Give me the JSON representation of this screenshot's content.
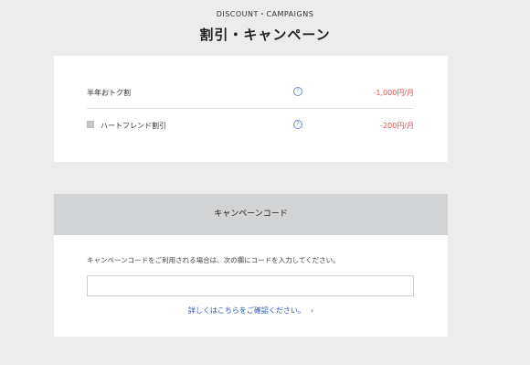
{
  "header": {
    "eyebrow": "DISCOUNT・CAMPAIGNS",
    "title": "割引・キャンペーン"
  },
  "discounts": [
    {
      "label": "半年おトク割",
      "help_icon": "question-circle-icon",
      "amount": "-1,000円/月"
    },
    {
      "label": "ハートフレンド割引",
      "help_icon": "question-circle-icon",
      "amount": "-200円/月",
      "checkbox_checked": false
    }
  ],
  "campaign": {
    "header": "キャンペーンコード",
    "description": "キャンペーンコードをご利用される場合は、次の欄にコードを入力してください。",
    "input_value": "",
    "link_label": "詳しくはこちらをご確認ください。",
    "link_icon": "chevron-right-icon"
  },
  "colors": {
    "background": "#ececec",
    "card": "#ffffff",
    "discount_amount": "#d9534f",
    "link": "#2e5aa8",
    "section_header": "#d2d3d4"
  }
}
